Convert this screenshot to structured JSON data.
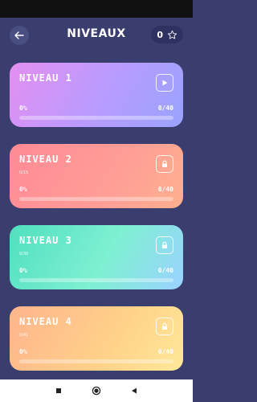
{
  "header": {
    "title": "NIVEAUX",
    "star_count": "0"
  },
  "levels": [
    {
      "title": "NIVEAU 1",
      "subtitle": "",
      "progress_label": "0%",
      "count": "0/40",
      "progress": 0,
      "state": "play"
    },
    {
      "title": "NIVEAU 2",
      "subtitle": "0/15",
      "progress_label": "0%",
      "count": "0/40",
      "progress": 0,
      "state": "locked"
    },
    {
      "title": "NIVEAU 3",
      "subtitle": "0/30",
      "progress_label": "0%",
      "count": "0/40",
      "progress": 0,
      "state": "locked"
    },
    {
      "title": "NIVEAU 4",
      "subtitle": "0/41",
      "progress_label": "0%",
      "count": "0/40",
      "progress": 0,
      "state": "locked"
    }
  ],
  "icons": {
    "back": "arrow-left-icon",
    "star": "star-outline-icon",
    "play": "play-icon",
    "lock": "lock-icon",
    "nav": [
      "stop-square-icon",
      "home-circle-icon",
      "back-triangle-icon"
    ]
  },
  "colors": {
    "background": "#3a3e6e",
    "card1": "#b79cff",
    "card2": "#ff9e97",
    "card3": "#7ff0d2",
    "card4": "#ffd28a"
  }
}
